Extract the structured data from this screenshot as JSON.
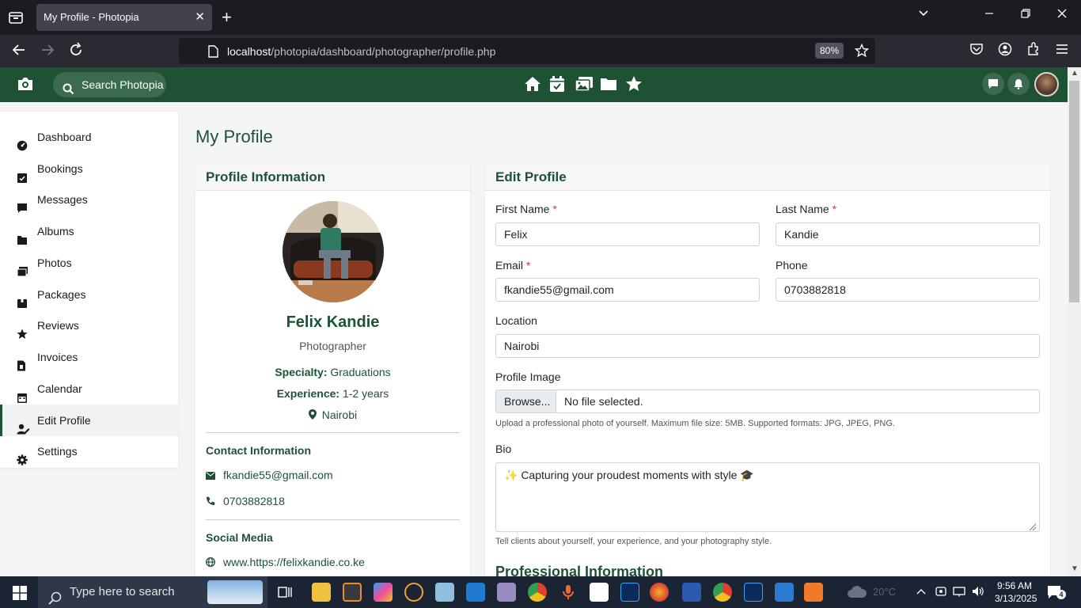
{
  "browser": {
    "tab_title": "My Profile - Photopia",
    "tab_close": "✕",
    "new_tab": "+",
    "url_host": "localhost",
    "url_path": "/photopia/dashboard/photographer/profile.php",
    "zoom": "80%"
  },
  "header": {
    "search_label": "Search Photopia",
    "icons": [
      "home-icon",
      "calendar-check-icon",
      "images-icon",
      "folder-icon",
      "star-icon"
    ]
  },
  "sidebar": {
    "items": [
      {
        "label": "Dashboard",
        "icon": "dashboard-icon"
      },
      {
        "label": "Bookings",
        "icon": "calendar-check-icon"
      },
      {
        "label": "Messages",
        "icon": "message-icon"
      },
      {
        "label": "Albums",
        "icon": "folder-icon"
      },
      {
        "label": "Photos",
        "icon": "images-icon"
      },
      {
        "label": "Packages",
        "icon": "box-icon"
      },
      {
        "label": "Reviews",
        "icon": "star-icon"
      },
      {
        "label": "Invoices",
        "icon": "invoice-icon"
      },
      {
        "label": "Calendar",
        "icon": "calendar-icon"
      },
      {
        "label": "Edit Profile",
        "icon": "user-edit-icon",
        "active": true
      },
      {
        "label": "Settings",
        "icon": "gear-icon"
      }
    ]
  },
  "page_title": "My Profile",
  "profile_info": {
    "heading": "Profile Information",
    "name": "Felix Kandie",
    "role": "Photographer",
    "specialty_label": "Specialty:",
    "specialty": "Graduations",
    "experience_label": "Experience:",
    "experience": "1-2 years",
    "location": "Nairobi",
    "contact_heading": "Contact Information",
    "email": "fkandie55@gmail.com",
    "phone": "0703882818",
    "social_heading": "Social Media",
    "website": "www.https://felixkandie.co.ke"
  },
  "edit_profile": {
    "heading": "Edit Profile",
    "first_name_label": "First Name",
    "first_name": "Felix",
    "last_name_label": "Last Name",
    "last_name": "Kandie",
    "email_label": "Email",
    "email": "fkandie55@gmail.com",
    "phone_label": "Phone",
    "phone": "0703882818",
    "location_label": "Location",
    "location": "Nairobi",
    "image_label": "Profile Image",
    "browse": "Browse...",
    "no_file": "No file selected.",
    "image_help": "Upload a professional photo of yourself. Maximum file size: 5MB. Supported formats: JPG, JPEG, PNG.",
    "bio_label": "Bio",
    "bio": "✨ Capturing your proudest moments with style 🎓",
    "bio_help": "Tell clients about yourself, your experience, and your photography style.",
    "professional_heading": "Professional Information",
    "required_mark": "*"
  },
  "taskbar": {
    "search_placeholder": "Type here to search",
    "weather": "20°C",
    "time": "9:56 AM",
    "date": "3/13/2025",
    "notifications": "4"
  },
  "colors": {
    "brand_green": "#1f5135",
    "required_red": "#dc3545"
  }
}
